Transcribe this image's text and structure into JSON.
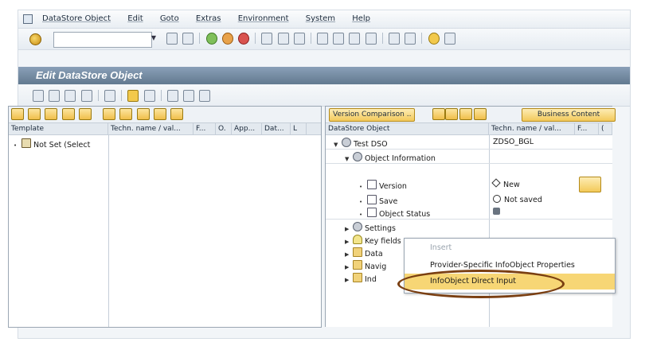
{
  "menubar": {
    "items": [
      "DataStore Object",
      "Edit",
      "Goto",
      "Extras",
      "Environment",
      "System",
      "Help"
    ]
  },
  "toolbar": {
    "command_field_value": ""
  },
  "title": "Edit DataStore Object",
  "left_pane": {
    "columns": [
      "Template",
      "Techn. name / val...",
      "F...",
      "O.",
      "App...",
      "Dat...",
      "L"
    ],
    "rows": [
      {
        "label": "Not Set (Select"
      }
    ]
  },
  "right_pane": {
    "buttons": {
      "version_comparison": "Version Comparison ..",
      "business_content": "Business Content"
    },
    "columns": [
      "DataStore Object",
      "Techn. name / val...",
      "F...",
      "("
    ],
    "tree": {
      "root": {
        "label": "Test DSO",
        "value": "ZDSO_BGL"
      },
      "object_information": "Object Information",
      "version": {
        "label": "Version",
        "value": "New"
      },
      "save": {
        "label": "Save",
        "value": "Not saved"
      },
      "object_status": {
        "label": "Object Status"
      },
      "settings": "Settings",
      "key_fields": "Key fields",
      "data_fields": "Data",
      "navigation": "Navig",
      "indexes": "Ind"
    }
  },
  "context_menu": {
    "items": [
      {
        "label": "Insert",
        "state": "disabled"
      },
      {
        "label": "Provider-Specific InfoObject Properties",
        "state": "normal"
      },
      {
        "label": "InfoObject Direct Input",
        "state": "selected"
      }
    ]
  },
  "colors": {
    "title_bar": "#62798f",
    "button_yellow": "#f3c95a",
    "selection": "#f7d675",
    "annotation_oval": "#7a3f12"
  }
}
